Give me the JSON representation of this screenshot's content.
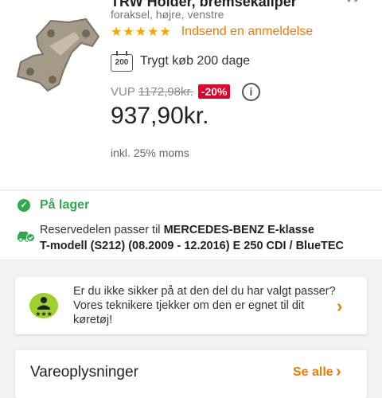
{
  "product": {
    "title": "TRW Holder, bremsekaliper",
    "subtitle": "foraksel, højre, venstre",
    "rating": {
      "stars": "★★★★★",
      "value": 5,
      "max": 5
    },
    "review_link": "Indsend en anmeldelse",
    "guarantee": {
      "days": "200",
      "text": "Trygt køb 200 dage"
    },
    "vup_label": "VUP",
    "old_price": "1172,98kr.",
    "discount": "-20%",
    "info_icon": "i",
    "price": "937,90kr.",
    "vat_note": "inkl. 25% moms"
  },
  "stock": {
    "status": "På lager",
    "fit_prefix": "Reservedelen passer til ",
    "vehicle_line1": "MERCEDES-BENZ E-klasse",
    "vehicle_line2": "T-modell (S212)",
    "vehicle_line2_plain": " (08.2009 - 12.2016) ",
    "vehicle_line3": "E 250 CDI / BlueTEC"
  },
  "help": {
    "text": "Er du ikke sikker på at den del du har valgt passer? Vores teknikere tjekker om den er egnet  til dit køretøj!",
    "chevron": "›"
  },
  "details": {
    "title": "Vareoplysninger",
    "see_all": "Se alle",
    "chevron": "›"
  },
  "icons": {
    "product": "brake-caliper-holder-image",
    "calendar": "calendar-200-icon",
    "info": "info-icon",
    "check": "check-circle-icon",
    "car": "car-check-icon",
    "tech": "technician-icon",
    "chevron": "chevron-right-icon"
  },
  "colors": {
    "accent": "#f07a00",
    "stars": "#f7a600",
    "discount": "#e4002b",
    "in_stock": "#2fa84f"
  }
}
